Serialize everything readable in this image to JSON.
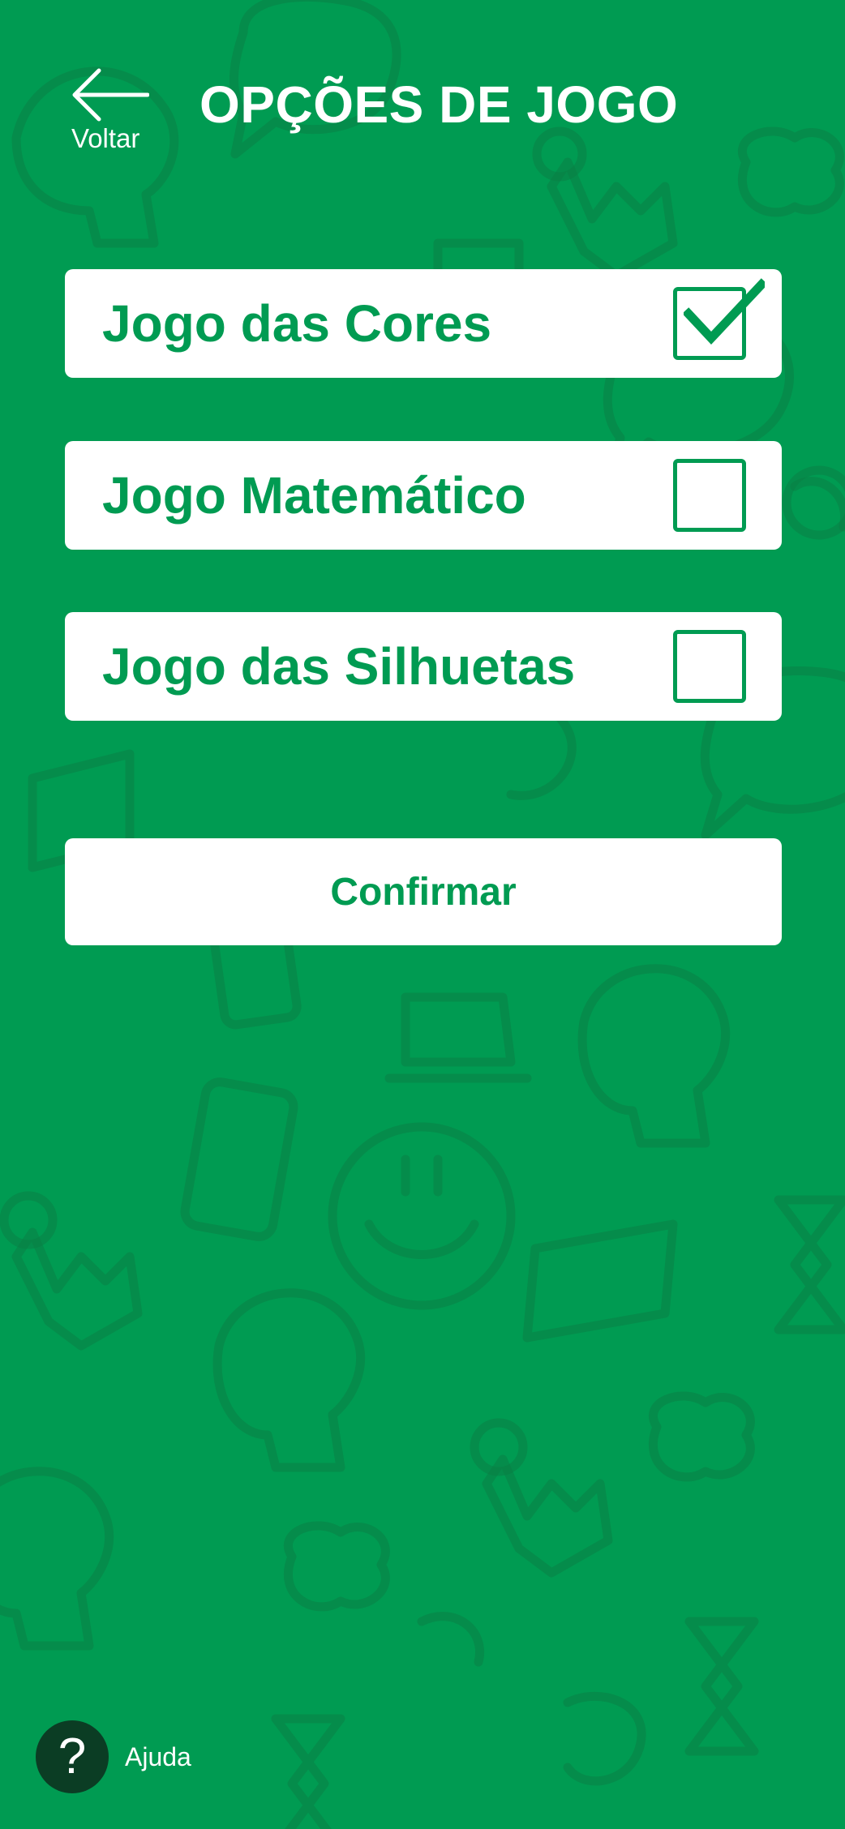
{
  "theme": {
    "background": "#009b52",
    "doodle_color": "#0a7f45",
    "card_background": "#ffffff",
    "accent": "#009b52",
    "help_button_background": "#0b3d24"
  },
  "header": {
    "back_icon": "arrow-left-icon",
    "back_label": "Voltar",
    "title": "OPÇÕES DE JOGO"
  },
  "options": [
    {
      "label": "Jogo das Cores",
      "checked": true
    },
    {
      "label": "Jogo Matemático",
      "checked": false
    },
    {
      "label": "Jogo das Silhuetas",
      "checked": false
    }
  ],
  "confirm": {
    "label": "Confirmar"
  },
  "help": {
    "icon": "question-mark-icon",
    "glyph": "?",
    "label": "Ajuda"
  }
}
